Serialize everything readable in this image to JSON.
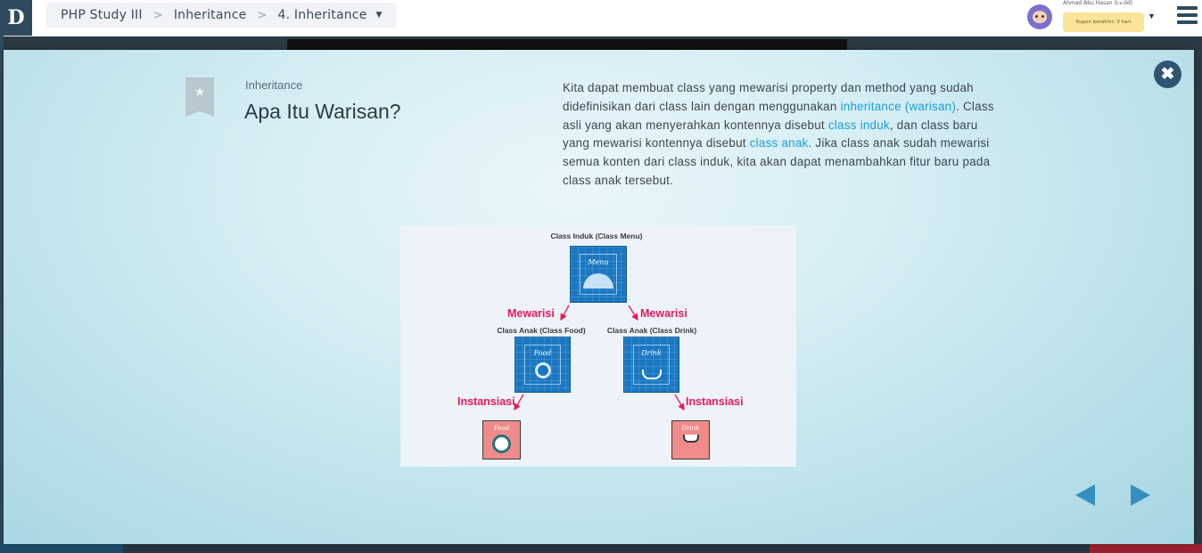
{
  "logo": {
    "glyph": "D"
  },
  "breadcrumb": {
    "items": [
      "PHP Study III",
      "Inheritance",
      "4. Inheritance"
    ],
    "separator": ">"
  },
  "user": {
    "name": "Ahmad Abu Hasan (Lv.dd)",
    "coupon": "Kupon berakhir: 3 hari"
  },
  "modal": {
    "subtitle": "Inheritance",
    "title": "Apa Itu Warisan?",
    "paragraph": {
      "p1": "Kita dapat membuat class yang mewarisi property dan method yang sudah didefinisikan dari class lain dengan menggunakan ",
      "h1": "inheritance (warisan)",
      "p2": ". Class asli yang akan menyerahkan kontennya disebut ",
      "h2": "class induk",
      "p3": ", dan class baru yang mewarisi kontennya disebut ",
      "h3": "class anak",
      "p4": ". Jika class anak sudah mewarisi semua konten dari class induk, kita akan dapat menambahkan fitur baru pada class anak tersebut."
    },
    "close_icon": "close-icon",
    "prev_icon": "prev-arrow-icon",
    "next_icon": "next-arrow-icon"
  },
  "diagram": {
    "parent_label": "Class Induk (Class Menu)",
    "parent_script": "Menu",
    "child_food_label": "Class Anak (Class Food)",
    "child_drink_label": "Class Anak (Class Drink)",
    "food_script": "Food",
    "drink_script": "Drink",
    "inherit_left": "Mewarisi",
    "inherit_right": "Mewarisi",
    "instance_left": "Instansiasi",
    "instance_right": "Instansiasi",
    "instance_food_script": "Food",
    "instance_drink_script": "Drink"
  },
  "colors": {
    "accent_link": "#1aa0d8",
    "class_box": "#1a78c2",
    "instance_box": "#ef8b8b",
    "arrow_label": "#e8195a",
    "nav_arrow": "#3590c0",
    "close_button": "#2f5670"
  }
}
